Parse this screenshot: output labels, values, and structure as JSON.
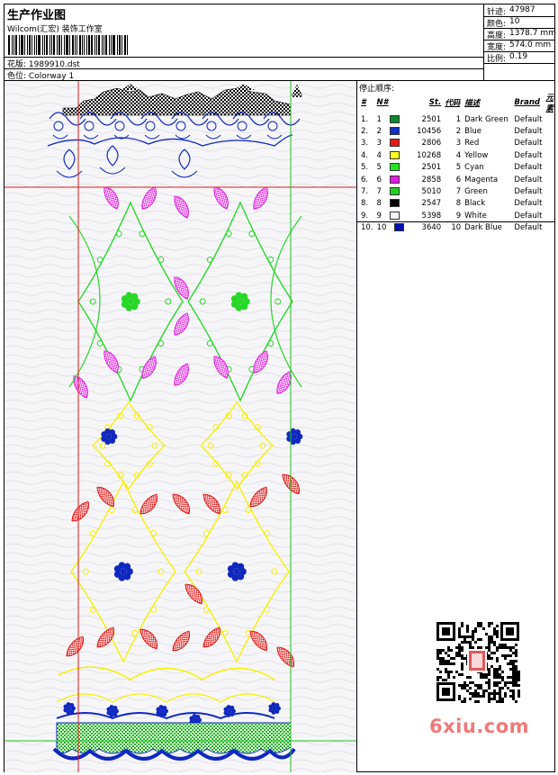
{
  "header": {
    "title": "生产作业图",
    "studio": "Wilcom(汇宏) 装饰工作室",
    "design_label": "花版:",
    "design_value": "1989910.dst",
    "colorway_label": "色位:",
    "colorway_value": "Colorway 1"
  },
  "specs": [
    {
      "label": "针迹:",
      "value": "47987"
    },
    {
      "label": "颜色:",
      "value": "10"
    },
    {
      "label": "高度:",
      "value": "1378.7 mm"
    },
    {
      "label": "宽度:",
      "value": "574.0 mm"
    },
    {
      "label": "比例:",
      "value": "0.19"
    }
  ],
  "stop_sequence": {
    "title": "停止顺序:",
    "headers": [
      "#",
      "N#",
      "St.",
      "代码",
      "描述",
      "Brand",
      "元素"
    ],
    "rows": [
      {
        "idx": "1.",
        "n": "1",
        "color": "#0a8a2a",
        "st": "2501",
        "code": "1",
        "desc": "Dark Green",
        "brand": "Default"
      },
      {
        "idx": "2.",
        "n": "2",
        "color": "#1030c8",
        "st": "10456",
        "code": "2",
        "desc": "Blue",
        "brand": "Default"
      },
      {
        "idx": "3.",
        "n": "3",
        "color": "#e81818",
        "st": "2806",
        "code": "3",
        "desc": "Red",
        "brand": "Default"
      },
      {
        "idx": "4.",
        "n": "4",
        "color": "#ffff20",
        "st": "10268",
        "code": "4",
        "desc": "Yellow",
        "brand": "Default"
      },
      {
        "idx": "5.",
        "n": "5",
        "color": "#20e820",
        "st": "2501",
        "code": "5",
        "desc": "Cyan",
        "brand": "Default"
      },
      {
        "idx": "6.",
        "n": "6",
        "color": "#e818e8",
        "st": "2858",
        "code": "6",
        "desc": "Magenta",
        "brand": "Default"
      },
      {
        "idx": "7.",
        "n": "7",
        "color": "#20d020",
        "st": "5010",
        "code": "7",
        "desc": "Green",
        "brand": "Default"
      },
      {
        "idx": "8.",
        "n": "8",
        "color": "#000000",
        "st": "2547",
        "code": "8",
        "desc": "Black",
        "brand": "Default"
      },
      {
        "idx": "9.",
        "n": "9",
        "color": "#f4f4f4",
        "st": "5398",
        "code": "9",
        "desc": "White",
        "brand": "Default"
      },
      {
        "idx": "10.",
        "n": "10",
        "color": "#0010b0",
        "st": "3640",
        "code": "10",
        "desc": "Dark Blue",
        "brand": "Default"
      }
    ]
  },
  "watermark": "6xiu.com",
  "palette": {
    "guide_red": "#e81818",
    "guide_green": "#20c020",
    "yellow": "#f8f000",
    "green": "#28d828",
    "blue": "#1028c0",
    "magenta": "#e020e0",
    "red": "#e01818"
  }
}
